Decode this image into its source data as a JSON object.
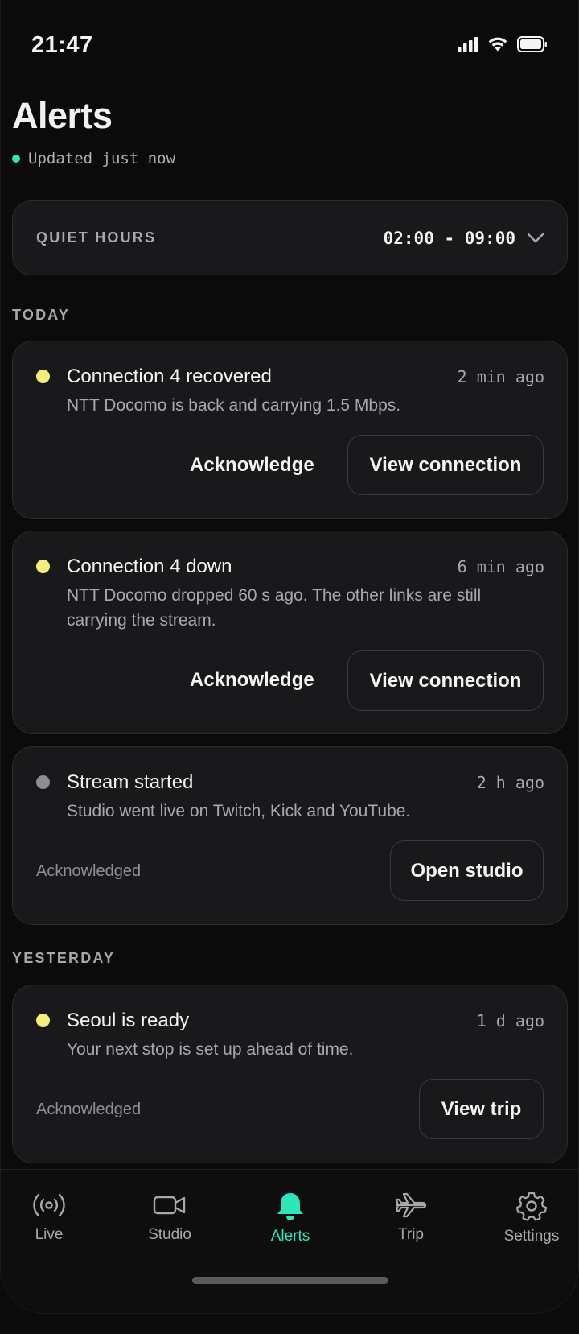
{
  "status_bar": {
    "time": "21:47"
  },
  "header": {
    "title": "Alerts",
    "updated": "Updated just now"
  },
  "quiet_hours": {
    "label": "QUIET HOURS",
    "value": "02:00 - 09:00"
  },
  "sections": {
    "today": "TODAY",
    "yesterday": "YESTERDAY"
  },
  "colors": {
    "accent": "#2ee6b8",
    "warning_dot": "#f4ef7a",
    "neutral_dot": "#8e8e92",
    "card_bg": "#19191b"
  },
  "alerts": [
    {
      "title": "Connection 4 recovered",
      "time": "2 min ago",
      "body": "NTT Docomo is back and carrying 1.5 Mbps.",
      "secondary_action": "Acknowledge",
      "primary_action": "View connection",
      "dot": "warning"
    },
    {
      "title": "Connection 4 down",
      "time": "6 min ago",
      "body": "NTT Docomo dropped 60 s ago. The other links are still carrying the stream.",
      "secondary_action": "Acknowledge",
      "primary_action": "View connection",
      "dot": "warning"
    },
    {
      "title": "Stream started",
      "time": "2 h ago",
      "body": "Studio went live on Twitch, Kick and YouTube.",
      "status": "Acknowledged",
      "primary_action": "Open studio",
      "dot": "neutral"
    },
    {
      "title": "Seoul is ready",
      "time": "1 d ago",
      "body": "Your next stop is set up ahead of time.",
      "status": "Acknowledged",
      "primary_action": "View trip",
      "dot": "warning"
    }
  ],
  "tabs": [
    {
      "label": "Live",
      "icon": "broadcast-icon"
    },
    {
      "label": "Studio",
      "icon": "video-camera-icon"
    },
    {
      "label": "Alerts",
      "icon": "bell-icon",
      "active": true
    },
    {
      "label": "Trip",
      "icon": "airplane-icon"
    },
    {
      "label": "Settings",
      "icon": "gear-icon"
    }
  ]
}
